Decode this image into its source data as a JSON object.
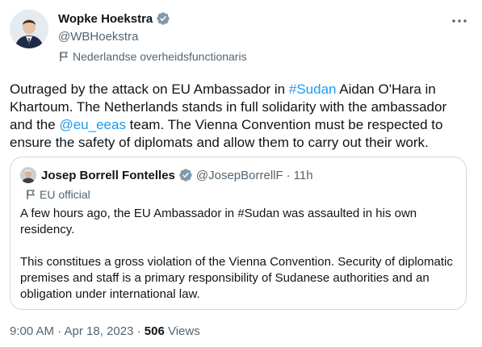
{
  "author": {
    "display_name": "Wopke Hoekstra",
    "handle": "@WBHoekstra",
    "affiliation": "Nederlandse overheidsfunctionaris"
  },
  "tweet": {
    "text_1": "Outraged by the attack on EU Ambassador in ",
    "hashtag": "#Sudan",
    "text_2": " Aidan O'Hara in Khartoum. The Netherlands stands in full solidarity with the ambassador and the ",
    "mention": "@eu_eeas",
    "text_3": " team. The Vienna Convention must be respected to ensure the safety of diplomats and allow them to carry out their work."
  },
  "quote": {
    "display_name": "Josep Borrell Fontelles",
    "handle": "@JosepBorrellF",
    "separator": "·",
    "time": "11h",
    "affiliation": "EU official",
    "paragraph_1": "A few hours ago, the EU Ambassador in #Sudan was assaulted in his own residency.",
    "paragraph_2": "This constitues a gross violation of the Vienna Convention. Security of diplomatic premises and staff is a primary responsibility of Sudanese authorities and an obligation under international law."
  },
  "footer": {
    "timestamp": "9:00 AM · Apr 18, 2023 · ",
    "views_count": "506",
    "views_label": " Views"
  },
  "colors": {
    "accent": "#1d9bf0",
    "secondary_text": "#536471",
    "border": "#cfd9de",
    "verified_badge": "#829aab"
  },
  "icons": {
    "verified": "verified-badge-icon",
    "affiliation": "flag-icon",
    "more": "more-options-icon"
  }
}
